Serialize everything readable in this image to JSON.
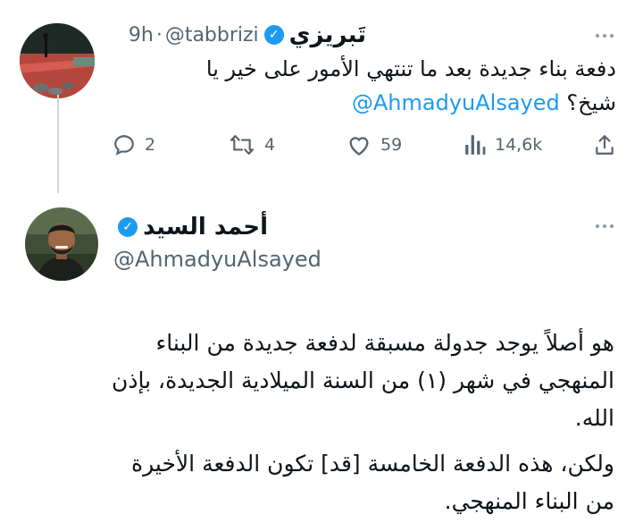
{
  "tweet1": {
    "display_name": "تَبريزي",
    "verified_mark": "✓",
    "handle": "@tabbrizi",
    "separator": "·",
    "time": "9h",
    "text_line1": "دفعة بناء جديدة بعد ما تنتهي الأمور على خير يا",
    "text_line2": "شيخ؟",
    "mention": "@AhmadyuAlsayed",
    "actions": {
      "reply": {
        "icon": "reply-icon",
        "count": "2"
      },
      "retweet": {
        "icon": "retweet-icon",
        "count": "4"
      },
      "like": {
        "icon": "heart-icon",
        "count": "59"
      },
      "views": {
        "icon": "views-icon",
        "count": "14,6k"
      },
      "share": {
        "icon": "share-icon"
      }
    }
  },
  "tweet2": {
    "display_name": "أحمد السيد",
    "verified_mark": "✓",
    "handle": "@AhmadyuAlsayed",
    "body_lines": [
      "هو أصلاً يوجد جدولة مسبقة لدفعة جديدة من البناء",
      "المنهجي في شهر (١) من السنة الميلادية الجديدة، بإذن",
      "الله.",
      "ولكن، هذه الدفعة الخامسة [قد] تكون الدفعة الأخيرة",
      "من البناء المنهجي."
    ]
  },
  "colors": {
    "accent": "#1d9bf0",
    "secondary_text": "#536471",
    "primary_text": "#0f1419",
    "thread_line": "#cfd9de"
  }
}
